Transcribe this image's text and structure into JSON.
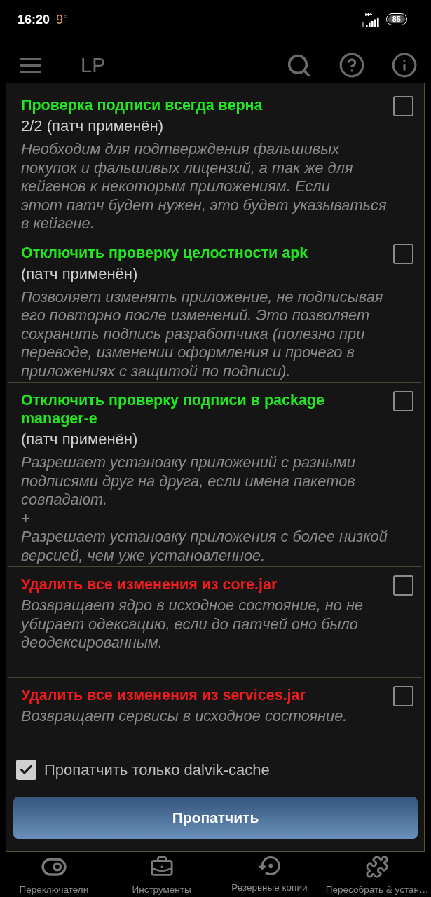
{
  "status_bar": {
    "time": "16:20",
    "temperature": "9°",
    "network": "H+",
    "battery": "85"
  },
  "app_bar": {
    "title": "LP"
  },
  "dialog": {
    "patches": [
      {
        "title": "Проверка подписи всегда верна",
        "color": "#22e622",
        "status": "2/2 (патч применён)",
        "description": "Необходим для подтверждения фальшивых покупок и фальшивых лицензий, а так же для кейгенов к некоторым приложениям. Если\nэтот патч будет нужен, это будет указываться в кейгене.",
        "checked": false
      },
      {
        "title": "Отключить проверку целостности apk",
        "color": "#22e622",
        "status": "(патч применён)",
        "description": "Позволяет изменять приложение, не подписывая его повторно после изменений. Это позволяет сохранить подпись разработчика (полезно при переводе, изменении оформления и прочего в приложениях с защитой по подписи).",
        "checked": false
      },
      {
        "title": "Отключить проверку подписи в package manager-e",
        "color": "#22e622",
        "status": "(патч применён)",
        "description": "Разрешает установку приложений с разными подписями друг на друга, если имена пакетов совпадают.\n+\nРазрешает установку приложения с более низкой версией, чем уже установленное.",
        "checked": false
      },
      {
        "title": "Удалить все изменения из core.jar",
        "color": "#ee1c1c",
        "description": "Возвращает ядро в исходное состояние, но не убирает одексацию, если до патчей оно было деодексированным.",
        "checked": false
      },
      {
        "title": "Удалить все изменения из services.jar",
        "color": "#ee1c1c",
        "description": "Возвращает сервисы в исходное состояние.",
        "checked": false
      }
    ],
    "option": {
      "label": "Пропатчить только dalvik-cache",
      "checked": true
    },
    "button": "Пропатчить"
  },
  "bottom_nav": [
    {
      "label": "Переключатели"
    },
    {
      "label": "Инструменты"
    },
    {
      "label": "Резервные копии"
    },
    {
      "label": "Пересобрать & устан…"
    }
  ]
}
